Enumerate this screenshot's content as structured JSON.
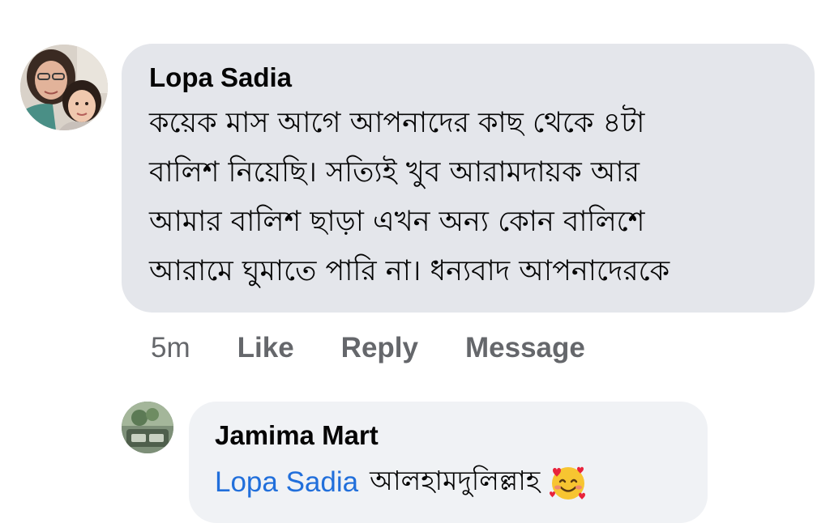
{
  "comment": {
    "author": "Lopa Sadia",
    "text_lines": [
      "কয়েক মাস আগে আপনাদের কাছ থেকে ৪টা",
      "বালিশ নিয়েছি। সত্যিই খুব আরামদায়ক আর",
      "আমার বালিশ ছাড়া এখন অন্য কোন বালিশে",
      "আরামে ঘুমাতে পারি না। ধন্যবাদ আপনাদেরকে"
    ],
    "time": "5m",
    "actions": {
      "like": "Like",
      "reply": "Reply",
      "message": "Message"
    },
    "avatar_icon": "profile-photo-icon"
  },
  "reply": {
    "author": "Jamima Mart",
    "mention": "Lopa Sadia",
    "text": "আলহামদুলিল্লাহ",
    "emoji_icon": "smiling-face-with-hearts-icon",
    "avatar_icon": "page-logo-icon"
  },
  "colors": {
    "bubble_main": "#e4e6eb",
    "bubble_reply": "#f0f2f5",
    "secondary_text": "#65676b",
    "mention_link": "#216fdb"
  }
}
